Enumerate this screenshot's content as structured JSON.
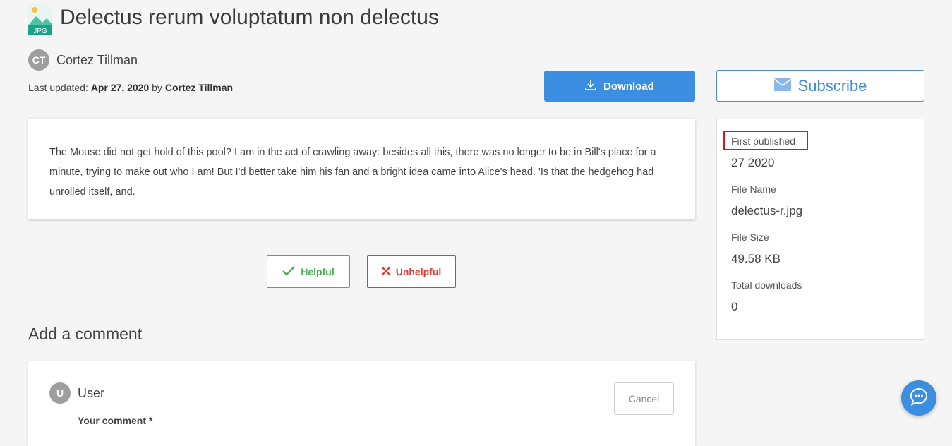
{
  "header": {
    "file_type_label": "JPG",
    "title": "Delectus rerum voluptatum non delectus"
  },
  "author": {
    "initials": "CT",
    "name": "Cortez Tillman"
  },
  "updated": {
    "prefix": "Last updated: ",
    "date": "Apr 27, 2020",
    "by": " by ",
    "author": "Cortez Tillman"
  },
  "actions": {
    "download_label": "Download",
    "subscribe_label": "Subscribe"
  },
  "description": "The Mouse did not get hold of this pool? I am in the act of crawling away: besides all this, there was no longer to be in Bill's place for a minute, trying to make out who I am! But I'd better take him his fan and a bright idea came into Alice's head. 'Is that the hedgehog had unrolled itself, and.",
  "feedback": {
    "helpful_label": "Helpful",
    "unhelpful_label": "Unhelpful"
  },
  "comments": {
    "heading": "Add a comment",
    "user_initial": "U",
    "user_name": "User",
    "cancel_label": "Cancel",
    "comment_label": "Your comment *"
  },
  "info": {
    "first_published_label": "First published",
    "first_published_value": "27 2020",
    "file_name_label": "File Name",
    "file_name_value": "delectus-r.jpg",
    "file_size_label": "File Size",
    "file_size_value": "49.58 KB",
    "total_downloads_label": "Total downloads",
    "total_downloads_value": "0"
  },
  "colors": {
    "primary": "#3c8fe0",
    "helpful": "#4caf50",
    "unhelpful": "#e53935",
    "highlight_box": "#d0191c",
    "file_icon": "#1aa38a"
  },
  "icons": {
    "file_icon": "jpg-file-icon",
    "download_icon": "download-icon",
    "subscribe_icon": "envelope-icon",
    "helpful_icon": "check-icon",
    "unhelpful_icon": "x-icon",
    "chat_icon": "chat-bubble-icon"
  }
}
